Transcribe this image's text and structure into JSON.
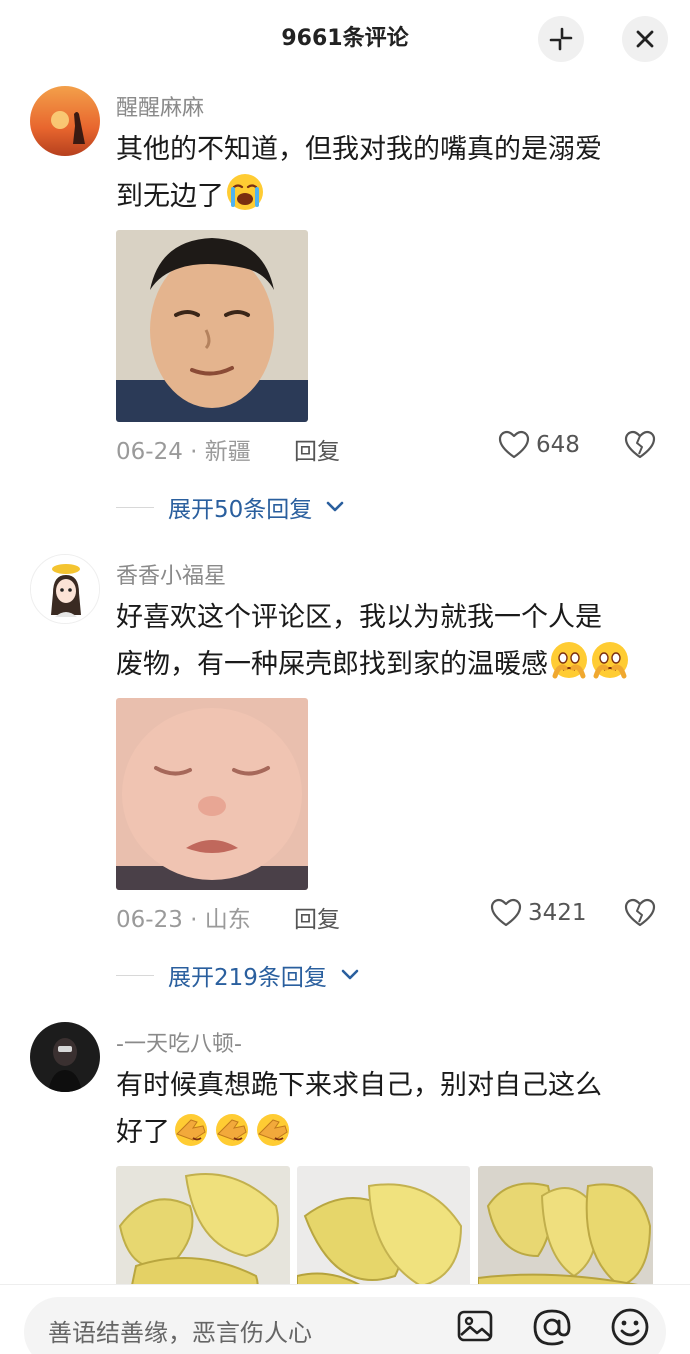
{
  "header": {
    "title": "9661条评论",
    "minimize_icon": "minimize-icon",
    "close_icon": "close-icon"
  },
  "comments": [
    {
      "username": "醒醒麻麻",
      "text_line1": "其他的不知道，但我对我的嘴真的是溺爱",
      "text_line2": "到无边了",
      "emojis": [
        "loudly-crying-emoji"
      ],
      "image": "smug-man-meme",
      "date": "06-24",
      "location": "新疆",
      "reply_label": "回复",
      "likes": "648",
      "expand_label": "展开50条回复"
    },
    {
      "username": "香香小福星",
      "text_line1": "好喜欢这个评论区，我以为就我一个人是",
      "text_line2": "废物，有一种屎壳郎找到家的温暖感",
      "emojis": [
        "holding-back-tears-emoji",
        "holding-back-tears-emoji"
      ],
      "image": "crying-baby-meme",
      "date": "06-23",
      "location": "山东",
      "reply_label": "回复",
      "likes": "3421",
      "expand_label": "展开219条回复"
    },
    {
      "username": "-一天吃八顿-",
      "text_line1": "有时候真想跪下来求自己，别对自己这么",
      "text_line2": "好了",
      "emojis": [
        "face-palm-emoji",
        "face-palm-emoji",
        "face-palm-emoji"
      ],
      "images": [
        "durian-photo",
        "durian-photo",
        "durian-photo"
      ]
    }
  ],
  "bottom_bar": {
    "placeholder": "善语结善缘，恶言伤人心",
    "image_icon": "image-icon",
    "mention_icon": "at-mention-icon",
    "emoji_icon": "emoji-icon"
  },
  "colors": {
    "link_blue": "#2a5f9e",
    "meta_gray": "#9a9a9a"
  }
}
